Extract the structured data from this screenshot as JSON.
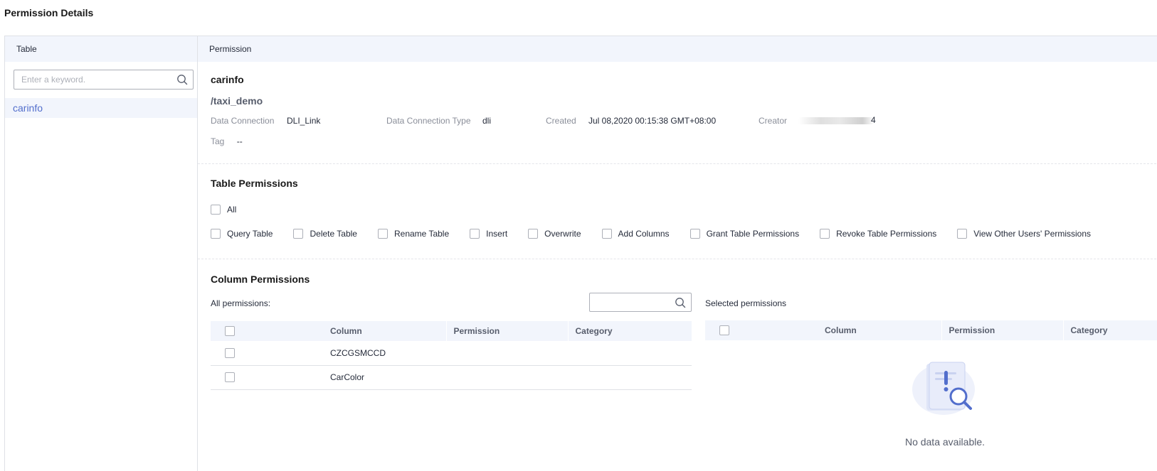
{
  "page_title": "Permission Details",
  "left_pane": {
    "header": "Table",
    "search": {
      "placeholder": "Enter a keyword.",
      "value": ""
    },
    "items": [
      "carinfo"
    ]
  },
  "right_pane": {
    "header": "Permission",
    "table_name": "carinfo",
    "database": "/taxi_demo",
    "meta": {
      "data_connection_label": "Data Connection",
      "data_connection_value": "DLI_Link",
      "connection_type_label": "Data Connection Type",
      "connection_type_value": "dli",
      "created_label": "Created",
      "created_value": "Jul 08,2020 00:15:38 GMT+08:00",
      "creator_label": "Creator",
      "creator_suffix": "4",
      "tag_label": "Tag",
      "tag_value": "--"
    },
    "table_permissions": {
      "title": "Table Permissions",
      "all_label": "All",
      "options": [
        "Query Table",
        "Delete Table",
        "Rename Table",
        "Insert",
        "Overwrite",
        "Add Columns",
        "Grant Table Permissions",
        "Revoke Table Permissions",
        "View Other Users' Permissions"
      ]
    },
    "column_permissions": {
      "title": "Column Permissions",
      "all_label": "All permissions:",
      "selected_label": "Selected permissions",
      "search_value": "",
      "columns": [
        "Column",
        "Permission",
        "Category"
      ],
      "rows": [
        {
          "column": "CZCGSMCCD",
          "permission": "",
          "category": ""
        },
        {
          "column": "CarColor",
          "permission": "",
          "category": ""
        }
      ],
      "empty_text": "No data available."
    }
  },
  "colors": {
    "accent": "#526ecc",
    "header_bg": "#f2f5fc",
    "border": "#dfe1e6"
  }
}
